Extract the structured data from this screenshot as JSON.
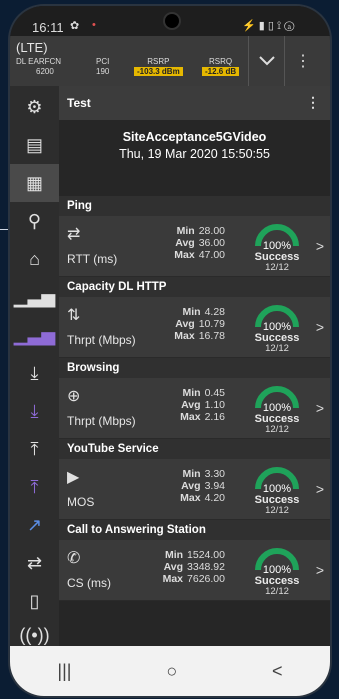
{
  "status": {
    "time": "16:11",
    "gear": "✿",
    "dot": "•",
    "icons_right": "⚡ ▮ ▯ ⟟ ⓐ"
  },
  "network": {
    "tech": "(LTE)",
    "earfcn_label": "DL EARFCN",
    "earfcn_value": "6200",
    "pci_label": "PCI",
    "pci_value": "190",
    "rsrp_label": "RSRP",
    "rsrp_value": "-103.3 dBm",
    "rsrq_label": "RSRQ",
    "rsrq_value": "-12.6 dB",
    "highlight_color": "#e6b800"
  },
  "sidebar": {
    "icons": [
      "gear-icon",
      "document-icon",
      "clipboard-icon",
      "location-pin-icon",
      "router-icon",
      "signal-bars-icon",
      "signal-bars-purple-icon",
      "download-icon",
      "download-purple-icon",
      "upload-icon",
      "upload-purple-icon",
      "trend-icon",
      "transfer-icon",
      "phone-device-icon",
      "antenna-icon"
    ]
  },
  "test": {
    "title": "Test",
    "site_name": "SiteAcceptance5GVideo",
    "datetime": "Thu, 19 Mar 2020 15:50:55"
  },
  "sections": [
    {
      "title": "Ping",
      "label": "RTT (ms)",
      "min": "28.00",
      "avg": "36.00",
      "max": "47.00",
      "pct": "100%",
      "success": "Success",
      "fraction": "12/12",
      "success_ratio": 1.0
    },
    {
      "title": "Capacity DL HTTP",
      "label": "Thrpt (Mbps)",
      "min": "4.28",
      "avg": "10.79",
      "max": "16.78",
      "pct": "100%",
      "success": "Success",
      "fraction": "12/12",
      "success_ratio": 1.0
    },
    {
      "title": "Browsing",
      "label": "Thrpt (Mbps)",
      "min": "0.45",
      "avg": "1.10",
      "max": "2.16",
      "pct": "100%",
      "success": "Success",
      "fraction": "12/12",
      "success_ratio": 1.0
    },
    {
      "title": "YouTube Service",
      "label": "MOS",
      "min": "3.30",
      "avg": "3.94",
      "max": "4.20",
      "pct": "100%",
      "success": "Success",
      "fraction": "12/12",
      "success_ratio": 1.0
    },
    {
      "title": "Call to Answering Station",
      "label": "CS (ms)",
      "min": "1524.00",
      "avg": "3348.92",
      "max": "7626.00",
      "pct": "100%",
      "success": "Success",
      "fraction": "12/12",
      "success_ratio": 1.0
    }
  ],
  "stat_keys": {
    "min": "Min",
    "avg": "Avg",
    "max": "Max"
  },
  "gauge_color": "#1fa35a",
  "nav": {
    "recents": "|||",
    "home": "○",
    "back": "<"
  }
}
